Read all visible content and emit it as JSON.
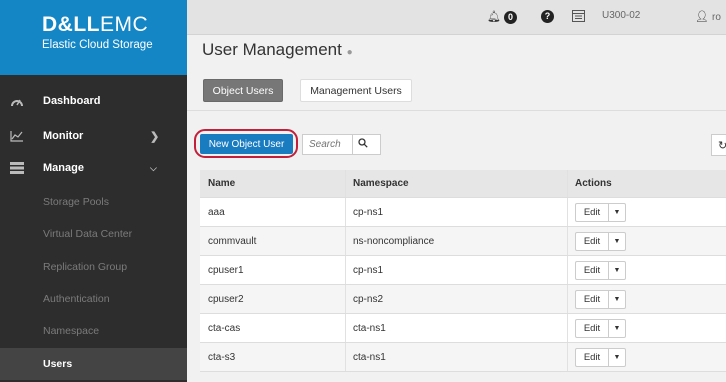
{
  "brand": {
    "logo_bold": "D&LL",
    "logo_rest": "EMC",
    "subtitle": "Elastic Cloud Storage"
  },
  "nav": {
    "dashboard": "Dashboard",
    "monitor": "Monitor",
    "manage": "Manage",
    "sub_items": [
      "Storage Pools",
      "Virtual Data Center",
      "Replication Group",
      "Authentication",
      "Namespace",
      "Users"
    ],
    "active_sub": "Users"
  },
  "topbar": {
    "alert_count": "0",
    "vdc": "U300-02",
    "user": "ro"
  },
  "page": {
    "title": "User Management",
    "tabs": [
      "Object Users",
      "Management Users"
    ],
    "active_tab": "Object Users"
  },
  "toolbar": {
    "new_button": "New Object User",
    "search_placeholder": "Search"
  },
  "table": {
    "headers": [
      "Name",
      "Namespace",
      "Actions"
    ],
    "rows": [
      {
        "name": "aaa",
        "namespace": "cp-ns1",
        "action": "Edit"
      },
      {
        "name": "commvault",
        "namespace": "ns-noncompliance",
        "action": "Edit"
      },
      {
        "name": "cpuser1",
        "namespace": "cp-ns1",
        "action": "Edit"
      },
      {
        "name": "cpuser2",
        "namespace": "cp-ns2",
        "action": "Edit"
      },
      {
        "name": "cta-cas",
        "namespace": "cta-ns1",
        "action": "Edit"
      },
      {
        "name": "cta-s3",
        "namespace": "cta-ns1",
        "action": "Edit"
      }
    ]
  },
  "colors": {
    "brand_blue": "#1486c6",
    "sidebar_bg": "#2d2d2d",
    "primary_button": "#1a7cc0",
    "highlight_ring": "#c2203a"
  }
}
